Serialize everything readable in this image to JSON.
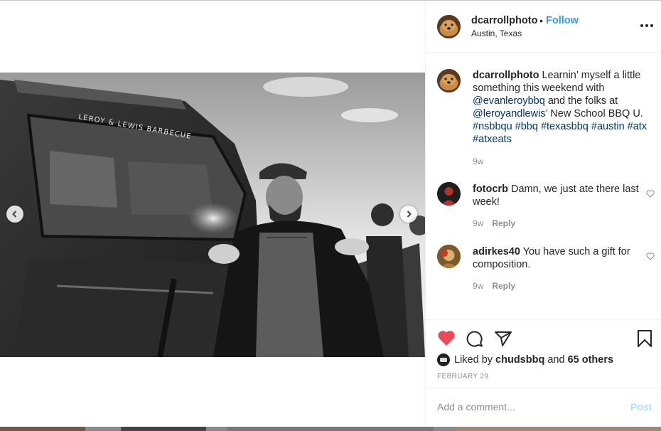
{
  "header": {
    "username": "dcarrollphoto",
    "dot": "•",
    "follow_label": "Follow",
    "location": "Austin, Texas",
    "more_icon": "ellipsis-icon"
  },
  "photo": {
    "truck_lettering": "LEROY & LEWIS BARBECUE"
  },
  "caption": {
    "username": "dcarrollphoto",
    "text_1": " Learnin’ myself a little something this weekend with ",
    "mention_1": "@evanleroybbq",
    "text_2": " and the folks at ",
    "mention_2": "@leroyandlewis",
    "text_3": "’ New School BBQ U. ",
    "hashtags": "#nsbbqu #bbq #texasbbq #austin #atx #atxeats",
    "time": "9w"
  },
  "comments": [
    {
      "username": "fotocrb",
      "text": " Damn, we just ate there last week!",
      "time": "9w",
      "reply": "Reply"
    },
    {
      "username": "adirkes40",
      "text": " You have such a gift for composition.",
      "time": "9w",
      "reply": "Reply"
    }
  ],
  "actions": {
    "liked_prefix": "Liked by ",
    "liked_user": "chudsbbq",
    "liked_mid": " and ",
    "liked_others": "65 others",
    "date": "FEBRUARY 29",
    "like_color": "#ed4956"
  },
  "add_comment": {
    "placeholder": "Add a comment...",
    "post_label": "Post"
  }
}
